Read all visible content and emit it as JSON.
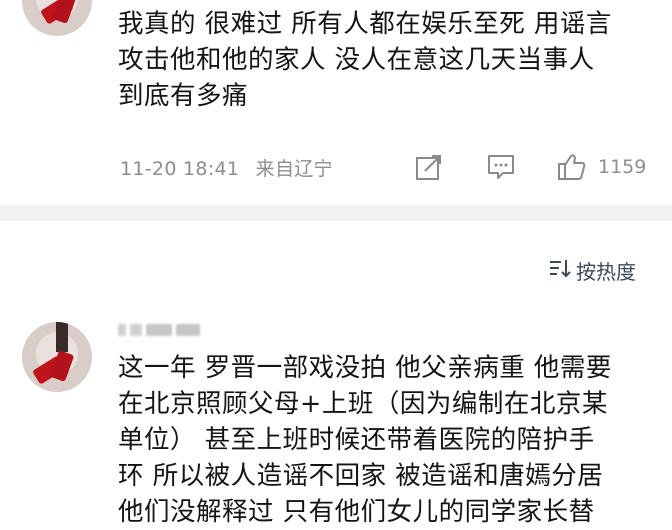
{
  "comments": [
    {
      "text_lines": [
        "我真的 很难过 所有人都在娱乐至死 用谣言",
        "攻击他和他的家人 没人在意这几天当事人",
        "到底有多痛"
      ],
      "date": "11-20 18:41",
      "location": "来自辽宁",
      "like_count": "1159"
    },
    {
      "text_lines": [
        "这一年 罗晋一部戏没拍 他父亲病重 他需要",
        "在北京照顾父母+上班（因为编制在北京某",
        "单位） 甚至上班时候还带着医院的陪护手",
        "环 所以被人造谣不回家 被造谣和唐嫣分居",
        "他们没解释过 只有他们女儿的同学家长替"
      ]
    }
  ],
  "sort": {
    "label": "按热度"
  },
  "icons": {
    "share": "share-icon",
    "comment": "comment-icon",
    "like": "thumbs-up-icon",
    "sort": "sort-icon"
  }
}
